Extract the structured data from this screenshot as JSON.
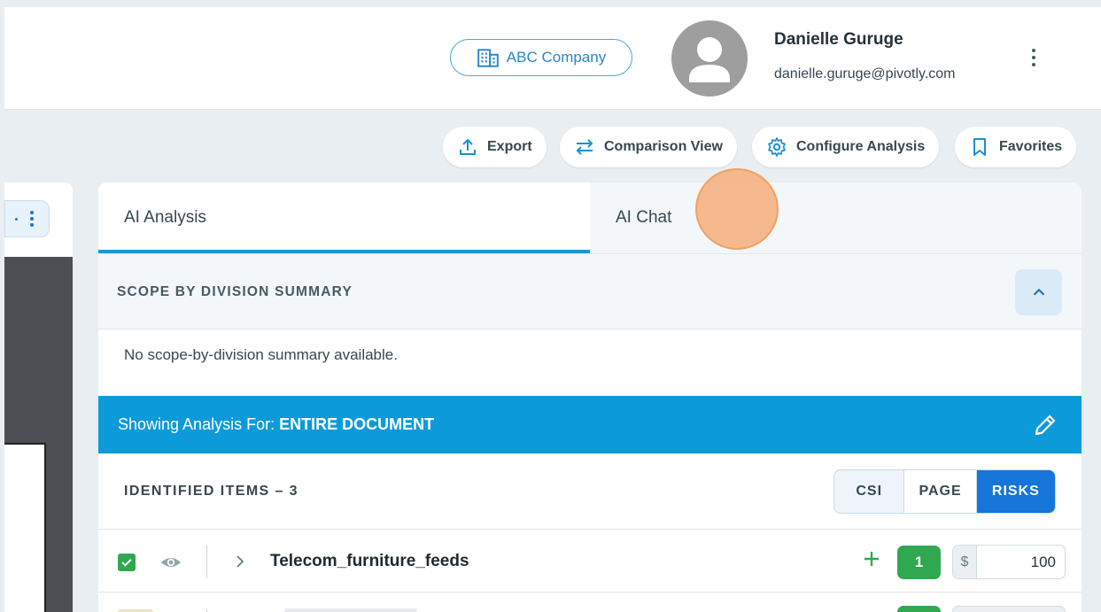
{
  "header": {
    "company_name": "ABC Company",
    "user_name": "Danielle Guruge",
    "user_email": "danielle.guruge@pivotly.com"
  },
  "toolbar": {
    "export_label": "Export",
    "comparison_label": "Comparison View",
    "configure_label": "Configure Analysis",
    "favorites_label": "Favorites"
  },
  "tabs": [
    {
      "label": "AI Analysis",
      "active": true
    },
    {
      "label": "AI Chat",
      "active": false
    }
  ],
  "scope_summary": {
    "title": "SCOPE BY DIVISION SUMMARY",
    "body": "No scope-by-division summary available."
  },
  "banner": {
    "prefix": "Showing Analysis For:",
    "value": "ENTIRE DOCUMENT"
  },
  "items": {
    "title": "IDENTIFIED ITEMS – 3",
    "view_options": [
      "CSI",
      "PAGE",
      "RISKS"
    ],
    "selected_view": "RISKS",
    "rows": [
      {
        "name": "Telecom_furniture_feeds",
        "checked": true,
        "count": "1",
        "currency": "$",
        "amount": "100"
      }
    ]
  },
  "colors": {
    "accent_blue": "#0d9ad9",
    "selected_segment": "#1575d9",
    "success_green": "#2fa84f",
    "cursor_highlight": "#f6b07e"
  }
}
